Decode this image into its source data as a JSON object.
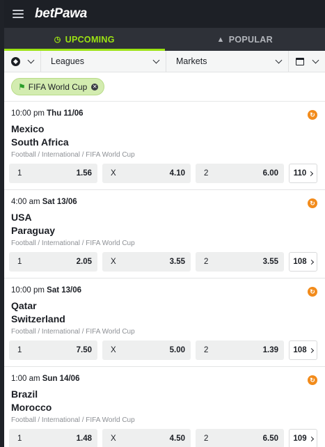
{
  "header": {
    "logo_part1": "bet",
    "logo_part2": "Pawa",
    "menu_icon": "hamburger-icon"
  },
  "tabs": [
    {
      "label": "UPCOMING",
      "icon": "clock-icon",
      "active": true
    },
    {
      "label": "POPULAR",
      "icon": "flame-icon",
      "active": false
    }
  ],
  "filters": {
    "sport_icon": "soccer-ball-icon",
    "leagues": "Leagues",
    "markets": "Markets",
    "date_icon": "calendar-icon"
  },
  "active_filter_chip": "FIFA World Cup",
  "colors": {
    "accent": "#9ce312",
    "header_bg": "#1d2026",
    "tab_bg": "#2e3138",
    "boost": "#f28b1b",
    "chip_bg": "#d3ecb0"
  },
  "events": [
    {
      "time": "10:00 pm",
      "date": "Thu 11/06",
      "home": "Mexico",
      "away": "South Africa",
      "competition": "Football / International / FIFA World Cup",
      "odds": [
        {
          "pick": "1",
          "price": "1.56"
        },
        {
          "pick": "X",
          "price": "4.10"
        },
        {
          "pick": "2",
          "price": "6.00"
        }
      ],
      "more_markets": "110"
    },
    {
      "time": "4:00 am",
      "date": "Sat 13/06",
      "home": "USA",
      "away": "Paraguay",
      "competition": "Football / International / FIFA World Cup",
      "odds": [
        {
          "pick": "1",
          "price": "2.05"
        },
        {
          "pick": "X",
          "price": "3.55"
        },
        {
          "pick": "2",
          "price": "3.55"
        }
      ],
      "more_markets": "108"
    },
    {
      "time": "10:00 pm",
      "date": "Sat 13/06",
      "home": "Qatar",
      "away": "Switzerland",
      "competition": "Football / International / FIFA World Cup",
      "odds": [
        {
          "pick": "1",
          "price": "7.50"
        },
        {
          "pick": "X",
          "price": "5.00"
        },
        {
          "pick": "2",
          "price": "1.39"
        }
      ],
      "more_markets": "108"
    },
    {
      "time": "1:00 am",
      "date": "Sun 14/06",
      "home": "Brazil",
      "away": "Morocco",
      "competition": "Football / International / FIFA World Cup",
      "odds": [
        {
          "pick": "1",
          "price": "1.48"
        },
        {
          "pick": "X",
          "price": "4.50"
        },
        {
          "pick": "2",
          "price": "6.50"
        }
      ],
      "more_markets": "109"
    }
  ]
}
